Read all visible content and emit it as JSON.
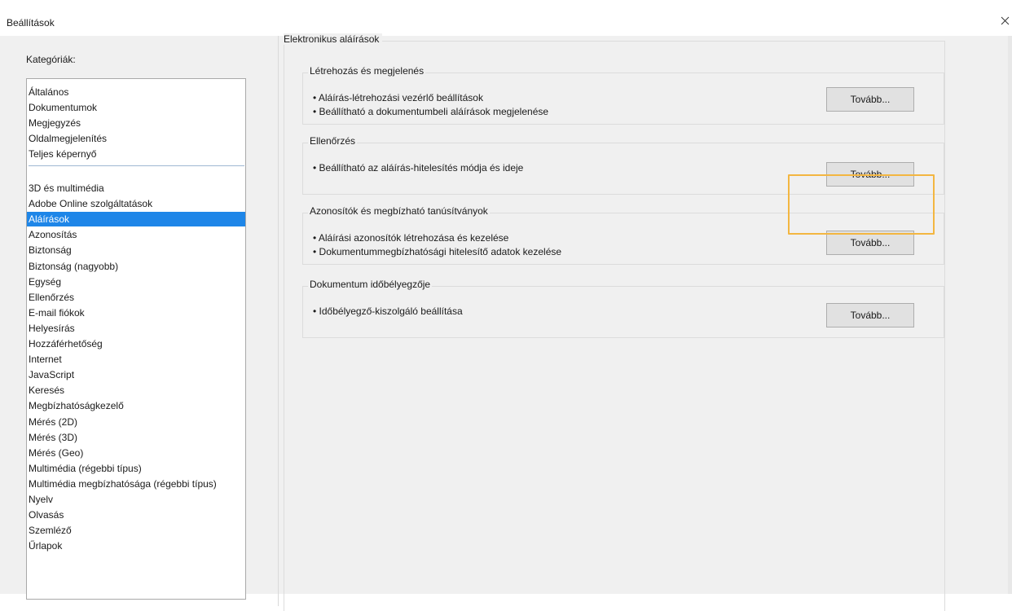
{
  "window": {
    "title": "Beállítások",
    "close_icon": "close-icon"
  },
  "categories": {
    "label": "Kategóriák:",
    "group_top": [
      "Általános",
      "Dokumentumok",
      "Megjegyzés",
      "Oldalmegjelenítés",
      "Teljes képernyő"
    ],
    "group_bottom": [
      "3D és multimédia",
      "Adobe Online szolgáltatások",
      "Aláírások",
      "Azonosítás",
      "Biztonság",
      "Biztonság (nagyobb)",
      "Egység",
      "Ellenőrzés",
      "E-mail fiókok",
      "Helyesírás",
      "Hozzáférhetőség",
      "Internet",
      "JavaScript",
      "Keresés",
      "Megbízhatóságkezelő",
      "Mérés (2D)",
      "Mérés (3D)",
      "Mérés (Geo)",
      "Multimédia (régebbi típus)",
      "Multimédia megbízhatósága (régebbi típus)",
      "Nyelv",
      "Olvasás",
      "Szemléző",
      "Űrlapok"
    ],
    "selected": "Aláírások",
    "selected_color": "#1e86e8"
  },
  "panel": {
    "title": "Elektronikus aláírások",
    "sections": [
      {
        "title": "Létrehozás és megjelenés",
        "bullets": [
          "• Aláírás-létrehozási vezérlő beállítások",
          "• Beállítható a dokumentumbeli aláírások megjelenése"
        ],
        "button": "Tovább..."
      },
      {
        "title": "Ellenőrzés",
        "bullets": [
          "• Beállítható az aláírás-hitelesítés módja és ideje"
        ],
        "button": "Tovább..."
      },
      {
        "title": "Azonosítók és megbízható tanúsítványok",
        "bullets": [
          "• Aláírási azonosítók létrehozása és kezelése",
          "• Dokumentummegbízhatósági hitelesítő adatok kezelése"
        ],
        "button": "Tovább..."
      },
      {
        "title": "Dokumentum időbélyegzője",
        "bullets": [
          "• Időbélyegző-kiszolgáló beállítása"
        ],
        "button": "Tovább..."
      }
    ]
  },
  "highlight_color": "#f3b641"
}
